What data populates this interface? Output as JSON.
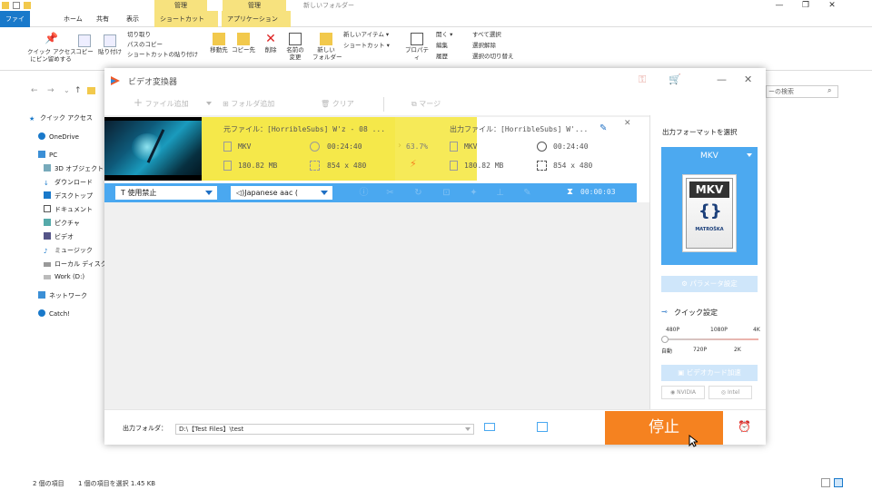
{
  "explorer": {
    "context_tabs": [
      "管理",
      "管理"
    ],
    "window_title": "新しいフォルダー",
    "tabs": [
      "ファイル",
      "ホーム",
      "共有",
      "表示",
      "ショートカット ツール",
      "アプリケーション ツール"
    ],
    "ribbon": {
      "pin": "クイック アクセス\nにピン留めする",
      "copy": "コピー",
      "paste": "貼り付け",
      "cut": "切り取り",
      "copy_path": "パスのコピー",
      "paste_shortcut": "ショートカットの貼り付け",
      "move_to": "移動先",
      "copy_to": "コピー先",
      "delete": "削除",
      "rename": "名前の\n変更",
      "new_folder": "新しい\nフォルダー",
      "new_item": "新しいアイテム ▾",
      "shortcut": "ショートカット ▾",
      "properties": "プロパティ",
      "open": "開く ▾",
      "edit": "編集",
      "history": "履歴",
      "select_all": "すべて選択",
      "select_none": "選択解除",
      "invert_selection": "選択の切り替え"
    },
    "search_placeholder": "ーの検索",
    "nav": [
      "クイック アクセス",
      "OneDrive",
      "PC",
      "3D オブジェクト",
      "ダウンロード",
      "デスクトップ",
      "ドキュメント",
      "ピクチャ",
      "ビデオ",
      "ミュージック",
      "ローカル ディスク (C",
      "Work (D:)",
      "ネットワーク",
      "Catch!"
    ],
    "status": {
      "items": "2 個の項目",
      "selected": "1 個の項目を選択  1.45 KB"
    }
  },
  "converter": {
    "title": "ビデオ変換器",
    "toolbar": {
      "add_file": "ファイル追加",
      "add_folder": "フォルダ追加",
      "clear": "クリア",
      "merge": "マージ"
    },
    "item": {
      "src_label": "元ファイル：[HorribleSubs] W'z - 08 ...",
      "dst_label": "出力ファイル：[HorribleSubs] W'...",
      "src_format": "MKV",
      "src_duration": "00:24:40",
      "src_size": "180.82 MB",
      "src_resolution": "854 x 480",
      "progress": "63.7%",
      "dst_format": "MKV",
      "dst_duration": "00:24:40",
      "dst_size": "180.82 MB",
      "dst_resolution": "854 x 480",
      "subtitle": "使用禁止",
      "audio": "Japanese aac (",
      "elapsed": "00:00:03"
    },
    "output_folder_label": "出力フォルダ：",
    "output_folder_path": "D:\\【Test Files】\\test",
    "stop_button": "停止",
    "right_panel": {
      "title": "出力フォーマットを選択",
      "format": "MKV",
      "badge_text": "MKV",
      "badge_sub": "MATROŠKA",
      "param_button": "パラメータ設定",
      "quick_settings": "クイック設定",
      "quality_top": [
        "480P",
        "1080P",
        "4K"
      ],
      "quality_bottom": [
        "自動",
        "720P",
        "2K"
      ],
      "gpu_button": "ビデオカード加速",
      "nvidia": "NVIDIA",
      "intel": "Intel"
    }
  }
}
